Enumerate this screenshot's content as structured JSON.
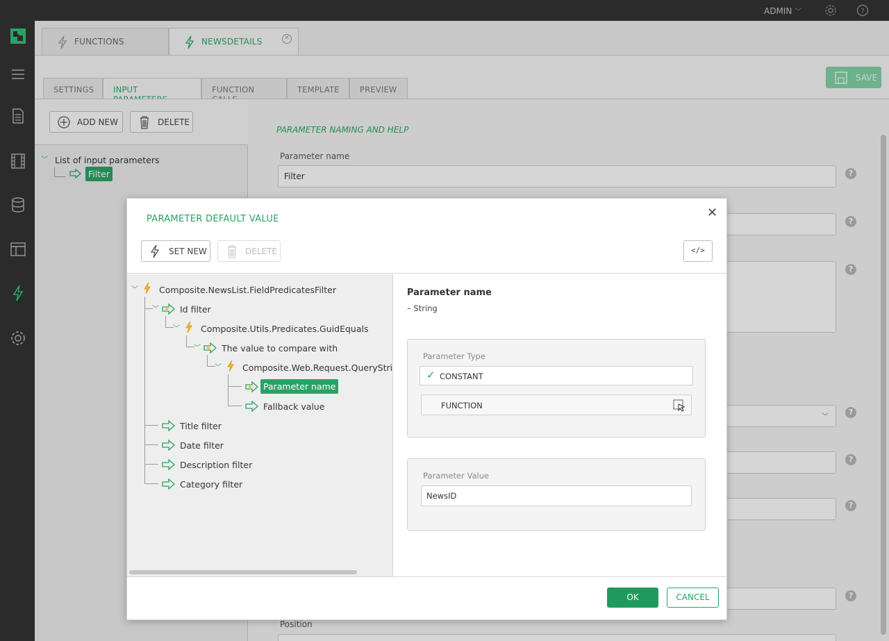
{
  "topbar": {
    "user": "ADMIN"
  },
  "tabs": [
    {
      "label": "FUNCTIONS"
    },
    {
      "label": "NEWSDETAILS"
    }
  ],
  "subtabs": [
    {
      "label": "SETTINGS"
    },
    {
      "label": "INPUT PARAMETERS"
    },
    {
      "label": "FUNCTION CALLS"
    },
    {
      "label": "TEMPLATE"
    },
    {
      "label": "PREVIEW"
    }
  ],
  "toolbar": {
    "save": "SAVE",
    "add_new": "ADD NEW",
    "delete": "DELETE"
  },
  "param_tree": {
    "root": "List of input parameters",
    "item": "Filter"
  },
  "form": {
    "section": "PARAMETER NAMING AND HELP",
    "name_label": "Parameter name",
    "name_value": "Filter",
    "position_label": "Position"
  },
  "dialog": {
    "title": "PARAMETER DEFAULT VALUE",
    "set_new": "SET NEW",
    "delete": "DELETE",
    "code_label": "</>",
    "tree": {
      "root": "Composite.NewsList.FieldPredicatesFilter",
      "id_filter": "Id filter",
      "guid": "Composite.Utils.Predicates.GuidEquals",
      "compare": "The value to compare with",
      "query": "Composite.Web.Request.QueryStringGuidValue",
      "param_name": "Parameter name",
      "fallback": "Fallback value",
      "title_filter": "Title filter",
      "date_filter": "Date filter",
      "desc_filter": "Description filter",
      "cat_filter": "Category filter"
    },
    "detail": {
      "heading": "Parameter name",
      "type_note": "– String",
      "type_group": "Parameter Type",
      "opt_constant": "CONSTANT",
      "opt_function": "FUNCTION",
      "value_group": "Parameter Value",
      "value": "NewsID"
    },
    "ok": "OK",
    "cancel": "CANCEL"
  },
  "colors": {
    "accent": "#2aa266",
    "dark": "#2b2b2b"
  }
}
